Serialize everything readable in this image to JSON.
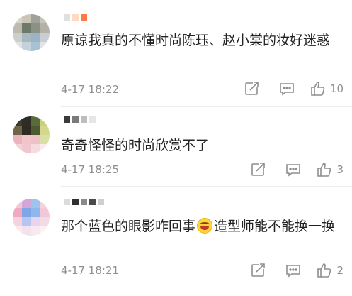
{
  "comments": [
    {
      "text": "原谅我真的不懂时尚陈珏、赵小棠的妆好迷惑",
      "time": "4-17 18:22",
      "likes": "10",
      "avatar_colors": [
        "#d8d4c8",
        "#c9c6b8",
        "#9fa19a",
        "#c8c6bc",
        "#bdbbb0",
        "#6c7a6a",
        "#8a9286",
        "#b4b2a6",
        "#cbd0cd",
        "#a7b8c0",
        "#9bb3c3",
        "#c9ced0",
        "#dfe3e3",
        "#c2d1da",
        "#a8c2d5",
        "#e1e4e6"
      ],
      "name_colors": [
        "#e0e0e0",
        "#ffd9c2",
        "#ff7a45"
      ]
    },
    {
      "text": "奇奇怪怪的时尚欣赏不了",
      "time": "4-17 18:25",
      "likes": "3",
      "avatar_colors": [
        "#3b3b2e",
        "#2e2e28",
        "#5a6a3a",
        "#c9d27a",
        "#6f6548",
        "#2f2a22",
        "#4b5a30",
        "#d3d88c",
        "#e9b4bd",
        "#f2c5cc",
        "#eec0c8",
        "#d9dfa6",
        "#f4d2d8",
        "#f0c7cf",
        "#f6dade",
        "#fbe9ec"
      ],
      "name_colors": [
        "#3a3a3a",
        "#7a7a7a",
        "#bdbdbd",
        "#e6e6e6"
      ]
    },
    {
      "prefix": "那个蓝色的眼影咋回事",
      "suffix": "造型师能不能换一换",
      "time": "4-17 18:21",
      "likes": "2",
      "avatar_colors": [
        "#f5c6d6",
        "#d3a6d9",
        "#9fc3ea",
        "#f1d3df",
        "#f2a7c2",
        "#7fa6e6",
        "#8fb6ef",
        "#f0c8d8",
        "#f6d2dc",
        "#b7c6f0",
        "#e7d4ee",
        "#f3dbe4",
        "#fbe7ee",
        "#f1e2ec",
        "#f7e9ef",
        "#fbf0f4"
      ],
      "name_colors": [
        "#dcdcdc",
        "#2f2f2f",
        "#8a8a8a",
        "#4a4a4a",
        "#cfcfcf"
      ]
    }
  ],
  "icons": {
    "share": "share-icon",
    "comment": "comment-icon",
    "like": "thumbs-up-icon",
    "emoji": "laughing-tears-emoji"
  }
}
